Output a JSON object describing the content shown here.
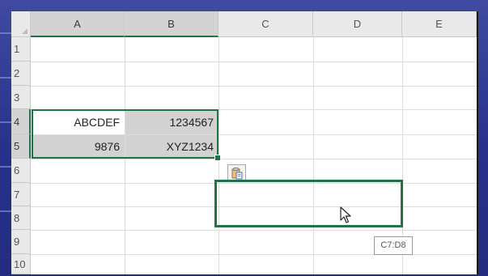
{
  "columns": [
    "A",
    "B",
    "C",
    "D",
    "E"
  ],
  "rows": [
    "1",
    "2",
    "3",
    "4",
    "5",
    "6",
    "7",
    "8",
    "9",
    "10"
  ],
  "cells": {
    "a4": "ABCDEF",
    "b4": "1234567",
    "a5": "9876",
    "b5": "XYZ1234"
  },
  "selection_range_tooltip": "C7:D8",
  "paste_options_icon": "clipboard-icon",
  "accent_color": "#217346"
}
